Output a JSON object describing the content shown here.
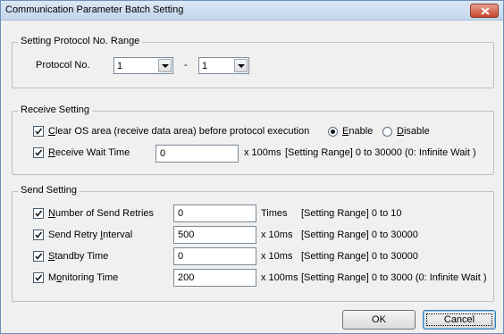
{
  "window": {
    "title": "Communication Parameter Batch Setting",
    "close_icon": "close-icon"
  },
  "protocol_range": {
    "legend": "Setting Protocol No. Range",
    "label": "Protocol No.",
    "from_value": "1",
    "separator": "-",
    "to_value": "1"
  },
  "receive": {
    "legend": "Receive Setting",
    "clear_os_label_pre": "C",
    "clear_os_label_rest": "lear OS area (receive data area) before protocol execution",
    "clear_os_checked": true,
    "enable_pre": "E",
    "enable_rest": "nable",
    "disable_pre": "D",
    "disable_rest": "isable",
    "selected": "Enable",
    "wait_label_pre": "R",
    "wait_label_rest": "eceive Wait Time",
    "wait_checked": true,
    "wait_value": "0",
    "wait_unit": "x 100ms",
    "wait_range": "[Setting Range] 0 to 30000 (0: Infinite Wait )"
  },
  "send": {
    "legend": "Send Setting",
    "rows": [
      {
        "label_pre": "N",
        "label_rest": "umber of Send Retries",
        "checked": true,
        "value": "0",
        "unit": "Times",
        "range": "[Setting Range] 0 to 10"
      },
      {
        "label_pre": "Send Retry ",
        "label_u": "I",
        "label_rest": "nterval",
        "checked": true,
        "value": "500",
        "unit": "x 10ms",
        "range": "[Setting Range] 0 to 30000"
      },
      {
        "label_pre": "S",
        "label_rest": "tandby Time",
        "checked": true,
        "value": "0",
        "unit": "x 10ms",
        "range": "[Setting Range] 0 to 30000"
      },
      {
        "label_pre": "M",
        "label_u": "o",
        "label_rest": "nitoring Time",
        "checked": true,
        "value": "200",
        "unit": "x 100ms",
        "range": "[Setting Range] 0 to 3000 (0: Infinite Wait )"
      }
    ]
  },
  "buttons": {
    "ok": "OK",
    "cancel": "Cancel"
  }
}
